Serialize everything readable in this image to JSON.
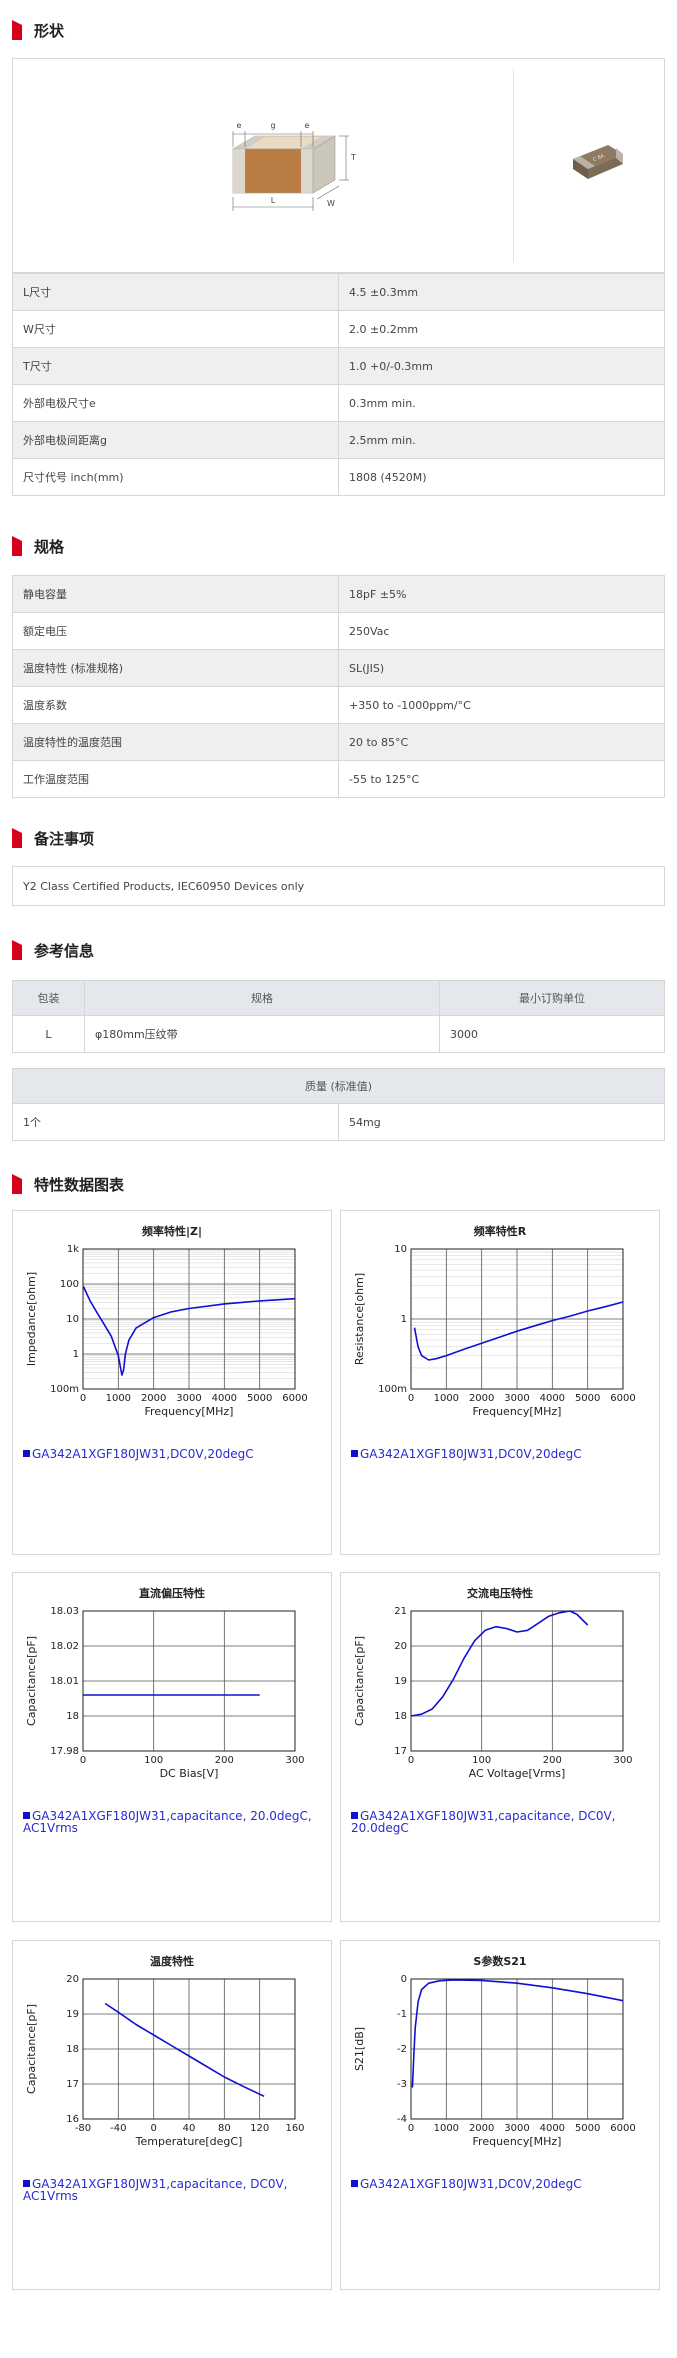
{
  "sections": {
    "shape": "形状",
    "spec": "规格",
    "notes": "备注事项",
    "reference": "参考信息",
    "charts": "特性数据图表"
  },
  "colors": {
    "accent": "#d6001c",
    "curve": "#1010d0",
    "header_bg": "#e4e7ec",
    "row_bg": "#efefef"
  },
  "shape_diagram": {
    "labels": [
      "e",
      "g",
      "e",
      "T",
      "W",
      "L"
    ]
  },
  "product_photo": {
    "marking": "C 8A"
  },
  "dimensions": [
    {
      "key": "L尺寸",
      "value": "4.5 ±0.3mm"
    },
    {
      "key": "W尺寸",
      "value": "2.0 ±0.2mm"
    },
    {
      "key": "T尺寸",
      "value": "1.0 +0/-0.3mm"
    },
    {
      "key": "外部电极尺寸e",
      "value": "0.3mm min."
    },
    {
      "key": "外部电极间距离g",
      "value": "2.5mm min."
    },
    {
      "key": "尺寸代号 inch(mm)",
      "value": "1808 (4520M)"
    }
  ],
  "specs": [
    {
      "key": "静电容量",
      "value": "18pF ±5%"
    },
    {
      "key": "额定电压",
      "value": "250Vac"
    },
    {
      "key": "温度特性 (标准规格)",
      "value": "SL(JIS)"
    },
    {
      "key": "温度系数",
      "value": "+350 to -1000ppm/°C"
    },
    {
      "key": "温度特性的温度范围",
      "value": "20 to 85°C"
    },
    {
      "key": "工作温度范围",
      "value": "-55 to 125°C"
    }
  ],
  "notes": "Y2 Class Certified Products, IEC60950 Devices only",
  "packaging": {
    "headers": [
      "包装",
      "规格",
      "最小订购单位"
    ],
    "rows": [
      {
        "code": "L",
        "spec": "φ180mm压纹带",
        "min": "3000"
      }
    ]
  },
  "mass": {
    "header": "质量 (标准值)",
    "rows": [
      {
        "unit": "1个",
        "value": "54mg"
      }
    ]
  },
  "chart_data": [
    {
      "type": "line",
      "title": "频率特性|Z|",
      "xlabel": "Frequency[MHz]",
      "ylabel": "Impedance[ohm]",
      "yscale": "log",
      "xlim": [
        0,
        6000
      ],
      "ylim": [
        0.1,
        1000
      ],
      "xticks": [
        "0",
        "1000",
        "2000",
        "3000",
        "4000",
        "5000",
        "6000"
      ],
      "yticks": [
        "100m",
        "1",
        "10",
        "100",
        "1k"
      ],
      "legend": "GA342A1XGF180JW31,DC0V,20degC",
      "x": [
        10,
        100,
        200,
        400,
        600,
        800,
        1000,
        1100,
        1150,
        1200,
        1300,
        1500,
        2000,
        2500,
        3000,
        4000,
        5000,
        6000
      ],
      "y": [
        85,
        55,
        33,
        15,
        7,
        3.2,
        0.9,
        0.25,
        0.35,
        1.0,
        2.5,
        5.5,
        11,
        16,
        20,
        27,
        33,
        38
      ]
    },
    {
      "type": "line",
      "title": "频率特性R",
      "xlabel": "Frequency[MHz]",
      "ylabel": "Resistance[ohm]",
      "yscale": "log",
      "xlim": [
        0,
        6000
      ],
      "ylim": [
        0.1,
        10
      ],
      "xticks": [
        "0",
        "1000",
        "2000",
        "3000",
        "4000",
        "5000",
        "6000"
      ],
      "yticks": [
        "100m",
        "1",
        "10"
      ],
      "legend": "GA342A1XGF180JW31,DC0V,20degC",
      "x": [
        100,
        200,
        300,
        500,
        700,
        1000,
        1500,
        2000,
        2500,
        3000,
        3500,
        4000,
        4500,
        5000,
        5500,
        6000
      ],
      "y": [
        0.75,
        0.4,
        0.3,
        0.26,
        0.27,
        0.3,
        0.37,
        0.45,
        0.55,
        0.67,
        0.8,
        0.95,
        1.1,
        1.3,
        1.5,
        1.75
      ]
    },
    {
      "type": "line",
      "title": "直流偏压特性",
      "xlabel": "DC Bias[V]",
      "ylabel": "Capacitance[pF]",
      "xlim": [
        0,
        300
      ],
      "ylim": [
        17.98,
        18.03
      ],
      "xticks": [
        "0",
        "100",
        "200",
        "300"
      ],
      "yticks": [
        "17.98",
        "18",
        "18.01",
        "18.02",
        "18.03"
      ],
      "legend": "GA342A1XGF180JW31,capacitance, 20.0degC, AC1Vrms",
      "x": [
        0,
        50,
        100,
        150,
        200,
        250
      ],
      "y": [
        18,
        18,
        18,
        18,
        18,
        18
      ]
    },
    {
      "type": "line",
      "title": "交流电压特性",
      "xlabel": "AC Voltage[Vrms]",
      "ylabel": "Capacitance[pF]",
      "xlim": [
        0,
        300
      ],
      "ylim": [
        17,
        21
      ],
      "xticks": [
        "0",
        "100",
        "200",
        "300"
      ],
      "yticks": [
        "17",
        "18",
        "19",
        "20",
        "21"
      ],
      "legend": "GA342A1XGF180JW31,capacitance, DC0V, 20.0degC",
      "x": [
        0,
        15,
        30,
        45,
        60,
        75,
        90,
        105,
        120,
        135,
        150,
        165,
        180,
        195,
        210,
        225,
        235,
        245,
        250
      ],
      "y": [
        18.0,
        18.05,
        18.2,
        18.55,
        19.05,
        19.65,
        20.15,
        20.45,
        20.55,
        20.5,
        20.4,
        20.45,
        20.65,
        20.85,
        20.95,
        21.0,
        20.9,
        20.7,
        20.6
      ]
    },
    {
      "type": "line",
      "title": "温度特性",
      "xlabel": "Temperature[degC]",
      "ylabel": "Capacitance[pF]",
      "xlim": [
        -80,
        160
      ],
      "ylim": [
        16,
        20
      ],
      "xticks": [
        "-80",
        "-40",
        "0",
        "40",
        "80",
        "120",
        "160"
      ],
      "yticks": [
        "16",
        "17",
        "18",
        "19",
        "20"
      ],
      "legend": "GA342A1XGF180JW31,capacitance, DC0V, AC1Vrms",
      "x": [
        -55,
        -40,
        -20,
        0,
        20,
        40,
        60,
        80,
        100,
        125
      ],
      "y": [
        19.3,
        19.05,
        18.7,
        18.4,
        18.1,
        17.8,
        17.5,
        17.2,
        16.95,
        16.65
      ]
    },
    {
      "type": "line",
      "title": "S参数S21",
      "xlabel": "Frequency[MHz]",
      "ylabel": "S21[dB]",
      "xlim": [
        0,
        6000
      ],
      "ylim": [
        -4,
        0
      ],
      "xticks": [
        "0",
        "1000",
        "2000",
        "3000",
        "4000",
        "5000",
        "6000"
      ],
      "yticks": [
        "-4",
        "-3",
        "-2",
        "-1",
        "0"
      ],
      "legend": "GA342A1XGF180JW31,DC0V,20degC",
      "x": [
        40,
        80,
        120,
        200,
        300,
        500,
        800,
        1200,
        2000,
        3000,
        4000,
        5000,
        6000
      ],
      "y": [
        -3.1,
        -2.2,
        -1.4,
        -0.65,
        -0.3,
        -0.12,
        -0.05,
        -0.03,
        -0.04,
        -0.12,
        -0.25,
        -0.42,
        -0.62
      ]
    }
  ]
}
